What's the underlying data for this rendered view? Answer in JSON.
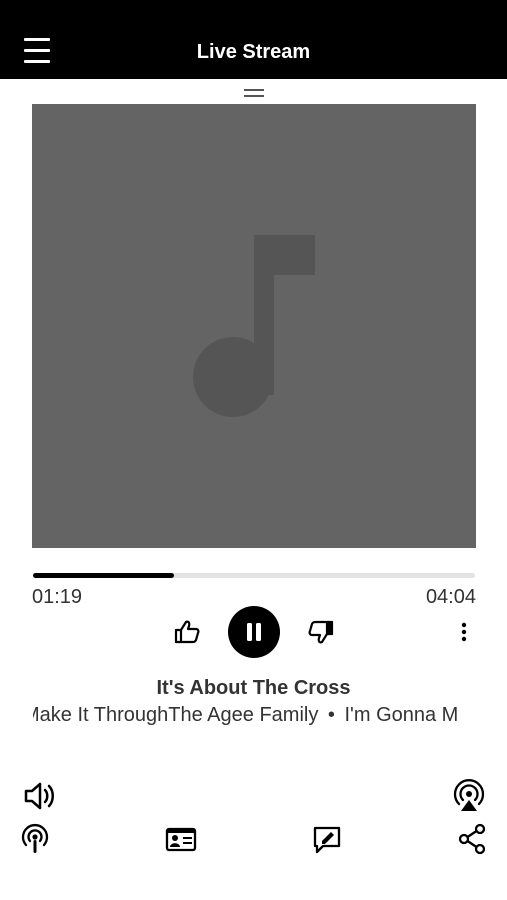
{
  "header": {
    "title": "Live Stream",
    "menu_icon": "hamburger-menu-icon"
  },
  "artwork": {
    "placeholder_icon": "music-note-icon",
    "background_color": "#646464"
  },
  "playback": {
    "elapsed": "01:19",
    "duration": "04:04",
    "progress_fraction": 0.32,
    "state": "playing"
  },
  "controls": {
    "like_icon": "thumbs-up-icon",
    "pause_icon": "pause-icon",
    "dislike_icon": "thumbs-down-icon",
    "more_icon": "more-vertical-icon"
  },
  "track": {
    "title": "It's About The Cross",
    "marquee_parts": [
      "Make It Through",
      "The Agee Family",
      "•",
      "I'm Gonna M"
    ]
  },
  "bottom_bar": {
    "icons": [
      "volume-icon",
      "airplay-icon",
      "podcast-icon",
      "contact-card-icon",
      "edit-note-icon",
      "share-icon"
    ]
  },
  "colors": {
    "header_bg": "#000000",
    "accent": "#000000",
    "track_bg": "#e3e3e3"
  }
}
